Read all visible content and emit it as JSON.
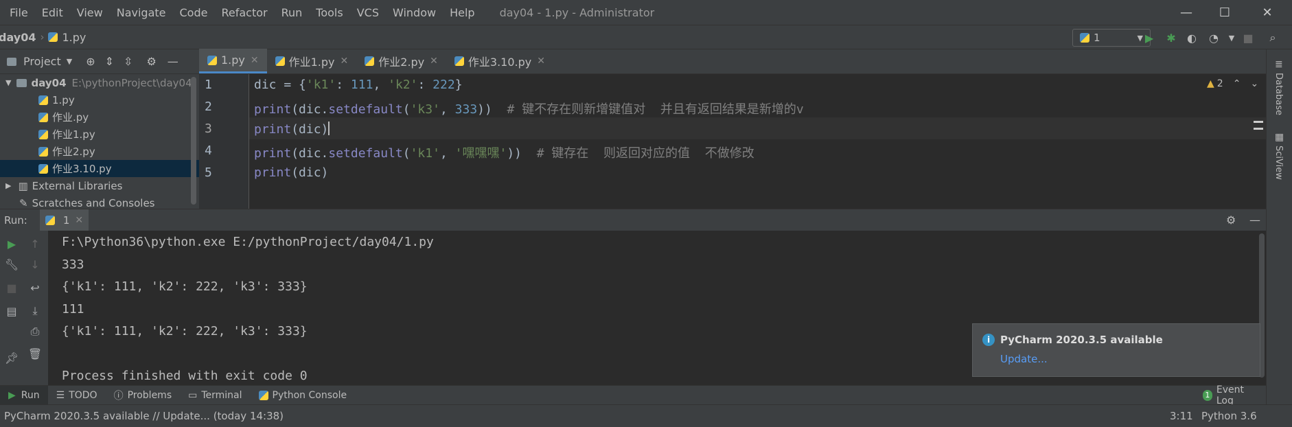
{
  "menu": [
    "File",
    "Edit",
    "View",
    "Navigate",
    "Code",
    "Refactor",
    "Run",
    "Tools",
    "VCS",
    "Window",
    "Help"
  ],
  "window_title": "day04 - 1.py - Administrator",
  "breadcrumb": {
    "project": "day04",
    "file": "1.py"
  },
  "run_config": {
    "selected": "1"
  },
  "project_panel": {
    "title": "Project",
    "root": {
      "name": "day04",
      "path": "E:\\pythonProject\\day04"
    },
    "files": [
      "1.py",
      "作业.py",
      "作业1.py",
      "作业2.py",
      "作业3.10.py"
    ],
    "selected_file": "作业3.10.py",
    "other": [
      "External Libraries",
      "Scratches and Consoles"
    ]
  },
  "tabs": [
    {
      "label": "1.py",
      "active": true
    },
    {
      "label": "作业1.py",
      "active": false
    },
    {
      "label": "作业2.py",
      "active": false
    },
    {
      "label": "作业3.10.py",
      "active": false
    }
  ],
  "editor": {
    "warnings": "2",
    "line_numbers": [
      "1",
      "2",
      "3",
      "4",
      "5"
    ],
    "lines": {
      "l1": {
        "a": "dic",
        "b": " = {",
        "c": "'k1'",
        "d": ": ",
        "e": "111",
        "f": ", ",
        "g": "'k2'",
        "h": ": ",
        "i": "222",
        "j": "}"
      },
      "l2": {
        "a": "print",
        "b": "(dic.",
        "c": "setdefault",
        "d": "(",
        "e": "'k3'",
        "f": ", ",
        "g": "333",
        "h": "))  ",
        "i": "# 键不存在则新增键值对  并且有返回结果是新增的v"
      },
      "l3": {
        "a": "print",
        "b": "(dic)"
      },
      "l4": {
        "a": "print",
        "b": "(dic.",
        "c": "setdefault",
        "d": "(",
        "e": "'k1'",
        "f": ", ",
        "g": "'嘿嘿嘿'",
        "h": "))  ",
        "i": "# 键存在  则返回对应的值  不做修改"
      },
      "l5": {
        "a": "print",
        "b": "(dic)"
      }
    }
  },
  "right_strip": {
    "database": "Database",
    "sciview": "SciView"
  },
  "run_panel": {
    "label": "Run:",
    "tab": "1"
  },
  "console": [
    "F:\\Python36\\python.exe E:/pythonProject/day04/1.py",
    "333",
    "{'k1': 111, 'k2': 222, 'k3': 333}",
    "111",
    "{'k1': 111, 'k2': 222, 'k3': 333}",
    "",
    "Process finished with exit code 0"
  ],
  "notification": {
    "title": "PyCharm 2020.3.5 available",
    "link": "Update..."
  },
  "bottom_tabs": [
    {
      "label": "Run",
      "active": true
    },
    {
      "label": "TODO",
      "active": false
    },
    {
      "label": "Problems",
      "active": false
    },
    {
      "label": "Terminal",
      "active": false
    },
    {
      "label": "Python Console",
      "active": false
    }
  ],
  "event_log": {
    "count": "1",
    "label": "Event Log"
  },
  "status": {
    "message": "PyCharm 2020.3.5 available // Update... (today 14:38)",
    "position": "3:11",
    "interpreter": "Python 3.6"
  }
}
